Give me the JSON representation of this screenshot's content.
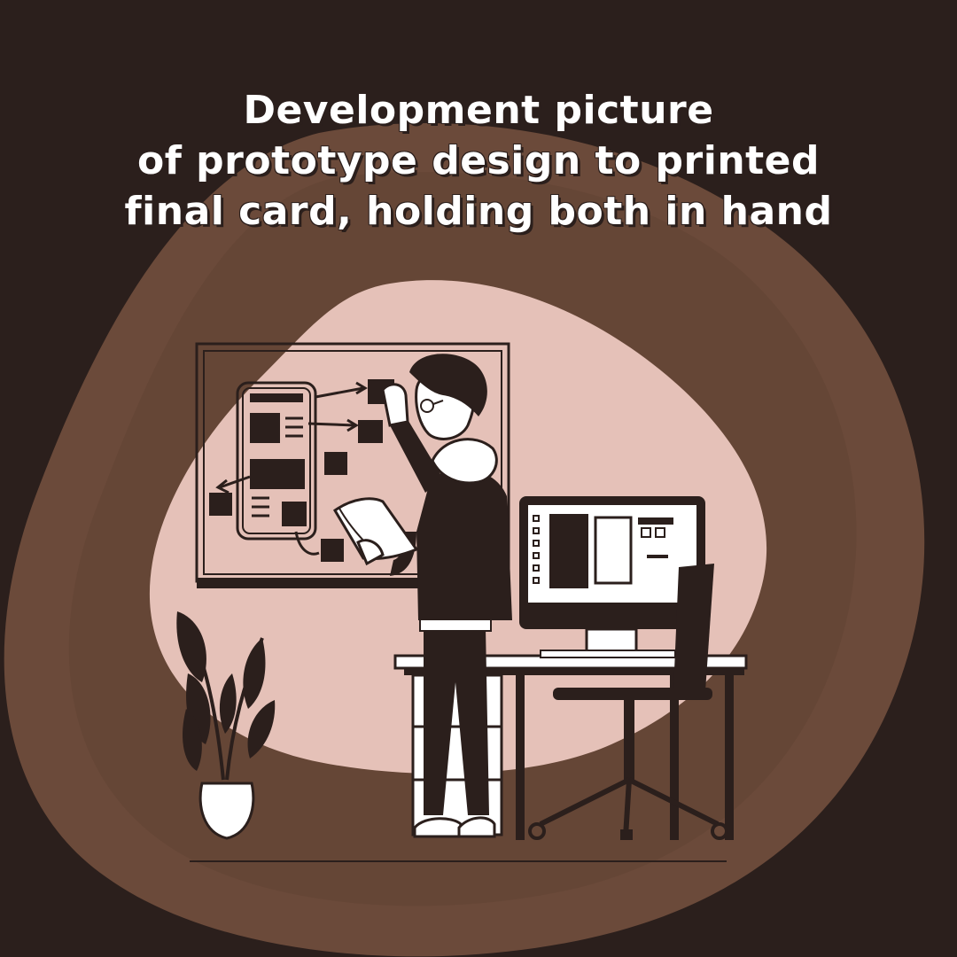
{
  "title": {
    "lines": [
      "Development picture",
      "of prototype design to printed",
      "final card, holding both in hand"
    ]
  },
  "colors": {
    "background": "#2b1f1c",
    "blob_outer": "#6b4a3a",
    "blob_inner": "#e5c1b8",
    "ink": "#2b1f1c",
    "paper": "#ffffff"
  },
  "icons": [
    "plant-icon",
    "person-icon",
    "monitor-icon",
    "desk-icon",
    "chair-icon",
    "whiteboard-icon"
  ]
}
